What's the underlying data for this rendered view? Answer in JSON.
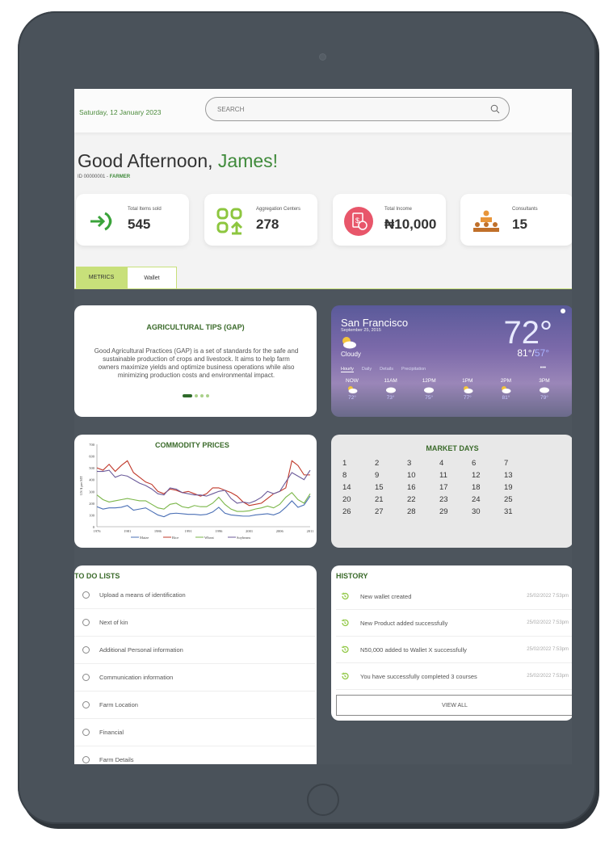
{
  "header": {
    "date": "Saturday, 12 January 2023",
    "search_placeholder": "SEARCH",
    "search_icon": "search-icon"
  },
  "greeting": {
    "text": "Good Afternoon, ",
    "name": "James!",
    "id_text": "ID 00000001 - ",
    "role": "FARMER"
  },
  "stats": [
    {
      "label": "Total Items sold",
      "value": "545",
      "icon": "harvest-arrow-icon"
    },
    {
      "label": "Aggregation Centers",
      "value": "278",
      "icon": "aggregation-icon"
    },
    {
      "label": "Total Income",
      "value": "₦10,000",
      "icon": "income-icon"
    },
    {
      "label": "Consultants",
      "value": "15",
      "icon": "consultants-icon"
    }
  ],
  "tabs": {
    "active": "METRICS",
    "inactive": "Wallet"
  },
  "tips": {
    "title": "AGRICULTURAL TIPS (GAP)",
    "body": "Good Agricultural Practices (GAP) is a set of standards for the safe and sustainable production of crops and livestock. It aims to help farm owners maximize yields and optimize business operations while also minimizing production costs and environmental impact."
  },
  "weather": {
    "city": "San Francisco",
    "date": "September 25, 2015",
    "temp": "72°",
    "high": "81°/",
    "low": "57°",
    "condition": "Cloudy",
    "tabs": [
      "Hourly",
      "Daily",
      "Details",
      "Precipitation"
    ],
    "more": "•••",
    "hours": [
      {
        "time": "NOW",
        "temp": "72°"
      },
      {
        "time": "11AM",
        "temp": "73°"
      },
      {
        "time": "12PM",
        "temp": "75°"
      },
      {
        "time": "1PM",
        "temp": "77°"
      },
      {
        "time": "2PM",
        "temp": "81°"
      },
      {
        "time": "3PM",
        "temp": "79°"
      }
    ]
  },
  "chart_data": {
    "type": "line",
    "title": "COMMODITY PRICES",
    "xlabel": "",
    "ylabel": "US $ per MT",
    "ylim": [
      0,
      700
    ],
    "yticks": [
      0,
      100,
      200,
      300,
      400,
      500,
      600,
      700
    ],
    "xticks": [
      1976,
      1981,
      1986,
      1991,
      1996,
      2001,
      2006,
      2011
    ],
    "x": [
      1976,
      1977,
      1978,
      1979,
      1980,
      1981,
      1982,
      1983,
      1984,
      1985,
      1986,
      1987,
      1988,
      1989,
      1990,
      1991,
      1992,
      1993,
      1994,
      1995,
      1996,
      1997,
      1998,
      1999,
      2000,
      2001,
      2002,
      2003,
      2004,
      2005,
      2006,
      2007,
      2008,
      2009,
      2010,
      2011
    ],
    "series": [
      {
        "name": "Maize",
        "color": "#4a6fb5",
        "values": [
          170,
          150,
          160,
          160,
          165,
          180,
          140,
          150,
          160,
          130,
          100,
          85,
          110,
          115,
          110,
          105,
          105,
          100,
          105,
          125,
          165,
          115,
          100,
          95,
          90,
          90,
          100,
          105,
          110,
          100,
          120,
          165,
          220,
          165,
          185,
          260
        ]
      },
      {
        "name": "Rice",
        "color": "#c0392b",
        "values": [
          500,
          480,
          530,
          470,
          520,
          560,
          460,
          420,
          380,
          360,
          300,
          280,
          320,
          310,
          290,
          300,
          280,
          260,
          280,
          330,
          330,
          310,
          290,
          260,
          210,
          180,
          190,
          200,
          240,
          280,
          300,
          330,
          560,
          520,
          440,
          440
        ]
      },
      {
        "name": "Wheat",
        "color": "#7ab648",
        "values": [
          270,
          230,
          210,
          220,
          230,
          240,
          230,
          220,
          220,
          190,
          160,
          150,
          190,
          200,
          170,
          160,
          180,
          170,
          170,
          200,
          250,
          190,
          150,
          130,
          130,
          135,
          150,
          160,
          175,
          160,
          190,
          250,
          290,
          230,
          200,
          280
        ]
      },
      {
        "name": "Soybeans",
        "color": "#6b5b9a",
        "values": [
          470,
          470,
          480,
          420,
          440,
          430,
          400,
          370,
          350,
          320,
          280,
          270,
          330,
          320,
          290,
          280,
          270,
          270,
          260,
          280,
          300,
          310,
          240,
          200,
          210,
          200,
          220,
          250,
          300,
          280,
          300,
          380,
          460,
          430,
          400,
          480
        ]
      }
    ]
  },
  "market": {
    "title": "MARKET DAYS",
    "days": [
      "1",
      "2",
      "3",
      "4",
      "6",
      "7",
      "8",
      "9",
      "10",
      "11",
      "12",
      "13",
      "14",
      "15",
      "16",
      "17",
      "18",
      "19",
      "20",
      "21",
      "22",
      "23",
      "24",
      "25",
      "26",
      "27",
      "28",
      "29",
      "30",
      "31"
    ]
  },
  "todo": {
    "title": "TO DO LISTS",
    "items": [
      "Upload  a means of identification",
      "Next of kin",
      "Additional Personal information",
      "Communication information",
      "Farm Location",
      "Financial",
      "Farm Details"
    ]
  },
  "history": {
    "title": "HISTORY",
    "items": [
      {
        "text": "New wallet created",
        "time": "25/02/2022 7:53pm"
      },
      {
        "text": "New Product added successfully",
        "time": "25/02/2022 7:53pm"
      },
      {
        "text": "N50,000 added to Wallet X successfully",
        "time": "25/02/2022 7:53pm"
      },
      {
        "text": "You have successfully completed 3 courses",
        "time": "25/02/2022 7:53pm"
      }
    ],
    "view_all": "VIEW ALL"
  }
}
